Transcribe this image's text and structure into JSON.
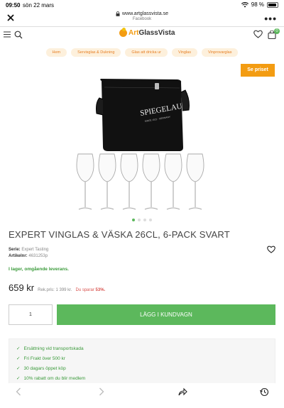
{
  "status": {
    "time": "09:50",
    "date": "sön 22 mars",
    "battery": "98 %"
  },
  "browser": {
    "url": "www.artglassvista.se",
    "source": "Facebook",
    "more": "•••"
  },
  "header": {
    "logo_part1": "Art",
    "logo_part2": "GlassVista",
    "cart_count": "0"
  },
  "breadcrumbs": [
    "Hem",
    "Servisglas & Dukning",
    "Glas att dricka ur",
    "Vinglas",
    "Vinprovarglas"
  ],
  "badge": "Se priset",
  "image": {
    "bag_brand": "SPIEGELAU",
    "bag_subtitle": "SINCE 1521 · GERMANY"
  },
  "carousel": {
    "count": 4,
    "active": 0
  },
  "product": {
    "title": "EXPERT VINGLAS & VÄSKA 26CL, 6-PACK SVART",
    "serie_label": "Serie:",
    "serie_value": "Expert Tasting",
    "sku_label": "Artikelnr:",
    "sku_value": "4631253p",
    "stock": "I lager, omgående leverans.",
    "price": "659 kr",
    "ref_price": "Rek.pris: 1 399 kr.",
    "save_label": "Du sparar",
    "save_pct": "53%."
  },
  "cart": {
    "qty": "1",
    "add_label": "LÄGG I KUNDVAGN"
  },
  "usps": [
    "Ersättning vid transportskada",
    "Fri Frakt över 500 kr",
    "30 dagars öppet köp",
    "10% rabatt om du blir medlem"
  ],
  "colors": {
    "accent": "#f39c12",
    "green": "#5cb85c",
    "red": "#d9534f"
  }
}
